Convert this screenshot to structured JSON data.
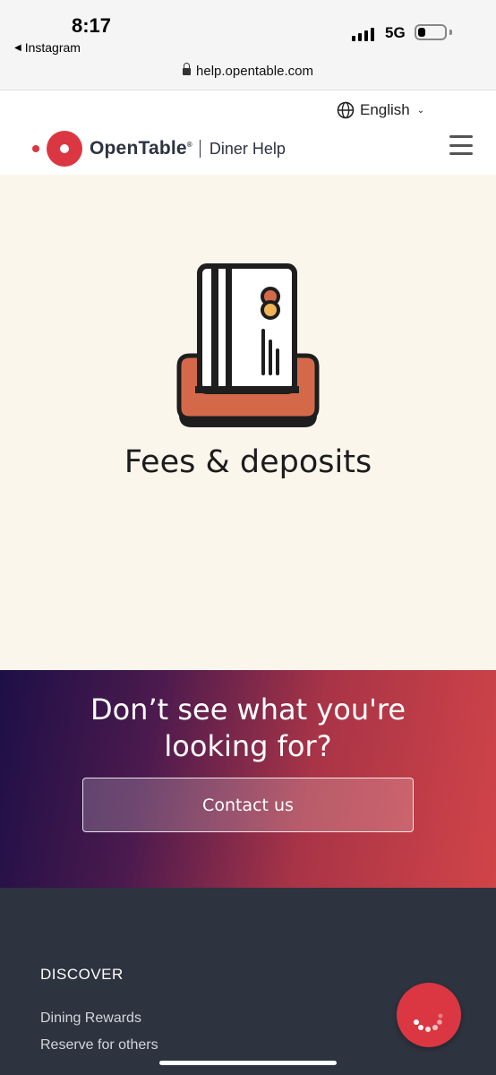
{
  "status_bar": {
    "time": "8:17",
    "back_app": "Instagram",
    "network": "5G",
    "battery_level": 0.3
  },
  "browser": {
    "url": "help.opentable.com"
  },
  "header": {
    "language": "English",
    "brand": "OpenTable",
    "brand_mark": "®",
    "section": "Diner Help"
  },
  "hero": {
    "title": "Fees & deposits",
    "icon": "credit-card-in-slot-icon"
  },
  "cta": {
    "title": "Don’t see what you're looking for?",
    "button_label": "Contact us"
  },
  "footer": {
    "heading": "DISCOVER",
    "links": [
      "Dining Rewards",
      "Reserve for others"
    ]
  },
  "colors": {
    "brand_red": "#da3743",
    "footer_bg": "#2d333f",
    "hero_bg": "#fbf6ec"
  }
}
